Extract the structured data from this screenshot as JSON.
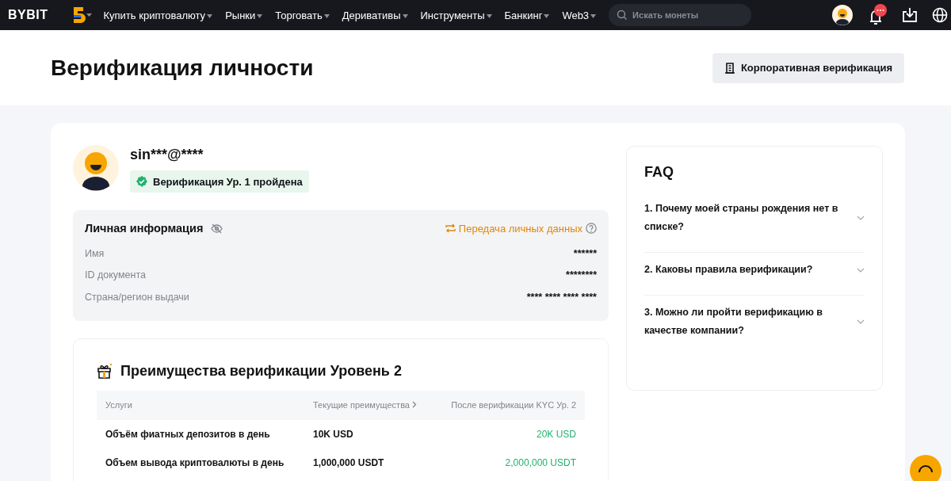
{
  "nav": {
    "logo": "BYBIT",
    "menu": [
      {
        "label": "Купить криптовалюту"
      },
      {
        "label": "Рынки"
      },
      {
        "label": "Торговать"
      },
      {
        "label": "Деривативы"
      },
      {
        "label": "Инструменты"
      },
      {
        "label": "Банкинг"
      },
      {
        "label": "Web3"
      }
    ],
    "search": {
      "placeholder": "Искать монеты"
    }
  },
  "header": {
    "title": "Верификация личности",
    "button": "Корпоративная верификация"
  },
  "profile": {
    "email": "sin***@****",
    "badge": "Верификация Ур. 1 пройдена"
  },
  "personal_info": {
    "title": "Личная информация",
    "link": "Передача личных данных",
    "rows": [
      {
        "label": "Имя",
        "value": "******"
      },
      {
        "label": "ID документа",
        "value": "********"
      },
      {
        "label": "Страна/регион выдачи",
        "value": "**** **** **** ****"
      }
    ]
  },
  "benefits": {
    "title": "Преимущества верификации Уровень 2",
    "columns": [
      "Услуги",
      "Текущие преимущества",
      "После верификации KYC Ур. 2"
    ],
    "rows": [
      [
        "Объём фиатных депозитов в день",
        "10K USD",
        "20K USD"
      ],
      [
        "Объем вывода криптовалюты в день",
        "1,000,000 USDT",
        "2,000,000 USDT"
      ]
    ]
  },
  "faq": {
    "title": "FAQ",
    "items": [
      {
        "question": "1. Почему моей страны рождения нет в списке?",
        "expanded": false
      },
      {
        "question": "2. Каковы правила верификации?",
        "expanded": false
      },
      {
        "question": "3. Можно ли пройти верификацию в качестве компании?",
        "expanded": false
      }
    ]
  }
}
